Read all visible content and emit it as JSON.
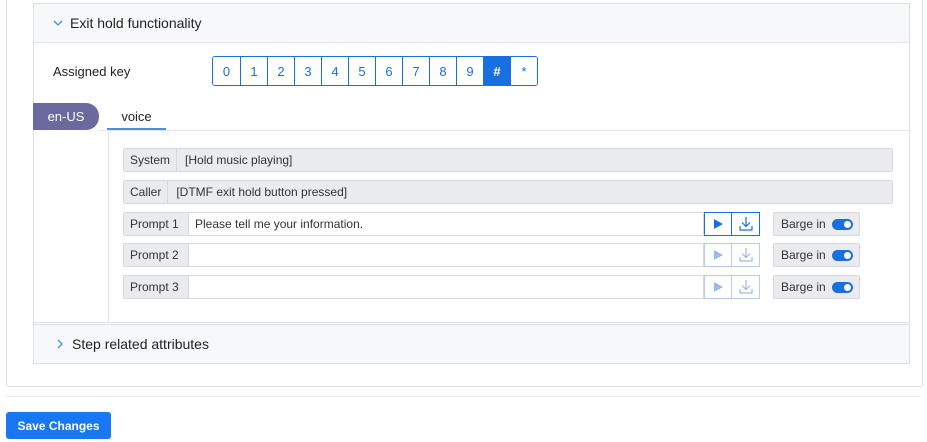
{
  "exit_hold": {
    "title": "Exit hold functionality",
    "assigned_key_label": "Assigned key",
    "keys": [
      "0",
      "1",
      "2",
      "3",
      "4",
      "5",
      "6",
      "7",
      "8",
      "9",
      "#",
      "*"
    ],
    "selected_key": "#"
  },
  "language_tab": "en-US",
  "channel_tab": "voice",
  "transcript": {
    "system": {
      "tag": "System",
      "text": "[Hold music playing]"
    },
    "caller": {
      "tag": "Caller",
      "text": "[DTMF exit hold button pressed]"
    }
  },
  "prompts": [
    {
      "label": "Prompt 1",
      "value": "Please tell me your information.",
      "barge_label": "Barge in",
      "barge_on": true
    },
    {
      "label": "Prompt 2",
      "value": "",
      "barge_label": "Barge in",
      "barge_on": true
    },
    {
      "label": "Prompt 3",
      "value": "",
      "barge_label": "Barge in",
      "barge_on": true
    }
  ],
  "step_attributes": {
    "title": "Step related attributes"
  },
  "save_button": "Save Changes",
  "icons": {
    "expand": "chevron-down-icon",
    "collapsed": "chevron-right-icon",
    "play": "play-icon",
    "download": "download-icon"
  },
  "colors": {
    "accent": "#1a6fe0",
    "lang_tab": "#6a6a9f",
    "save": "#1877f2"
  }
}
